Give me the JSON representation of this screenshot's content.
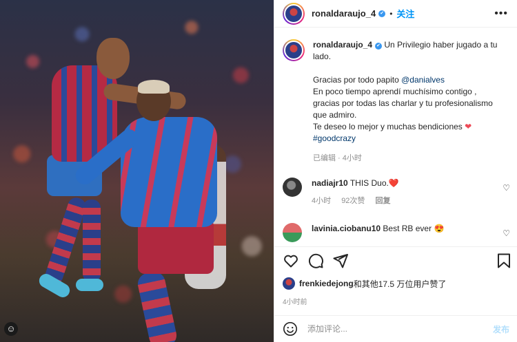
{
  "post": {
    "username": "ronaldaraujo_4",
    "follow_label": "关注",
    "more_label": "•••"
  },
  "caption": {
    "username": "ronaldaraujo_4",
    "line1": "Un Privilegio haber jugado a tu lado.",
    "line2_prefix": "Gracias por todo papito",
    "mention": "@danialves",
    "line3": "En poco tiempo aprendí muchísimo contigo , gracias por todas las charlar y tu profesionalismo que admiro.",
    "line4": "Te deseo lo mejor y muchas bendiciones",
    "hashtag": "#goodcrazy",
    "meta": "已编辑 · 4小时"
  },
  "comments": [
    {
      "username": "nadiajr10",
      "text": "THIS Duo.",
      "emoji": "❤️",
      "time": "4小时",
      "likes": "92次赞",
      "reply": "回复"
    },
    {
      "username": "lavinia.ciobanu10",
      "text": "Best RB ever",
      "emoji": "😍"
    }
  ],
  "likes": {
    "user": "frenkiedejong",
    "text": "和其他17.5 万位用户赞了"
  },
  "posted_time": "4小时前",
  "add_comment": {
    "placeholder": "添加评论...",
    "publish_label": "发布"
  },
  "colors": {
    "follow": "#0095f6",
    "verified": "#3897f0",
    "heart": "#ed4956",
    "publish_disabled": "#b2dffc"
  },
  "icons": [
    "heart-icon",
    "comment-icon",
    "share-icon",
    "bookmark-icon",
    "emoji-icon",
    "verified-icon",
    "more-icon",
    "like-heart-icon"
  ]
}
